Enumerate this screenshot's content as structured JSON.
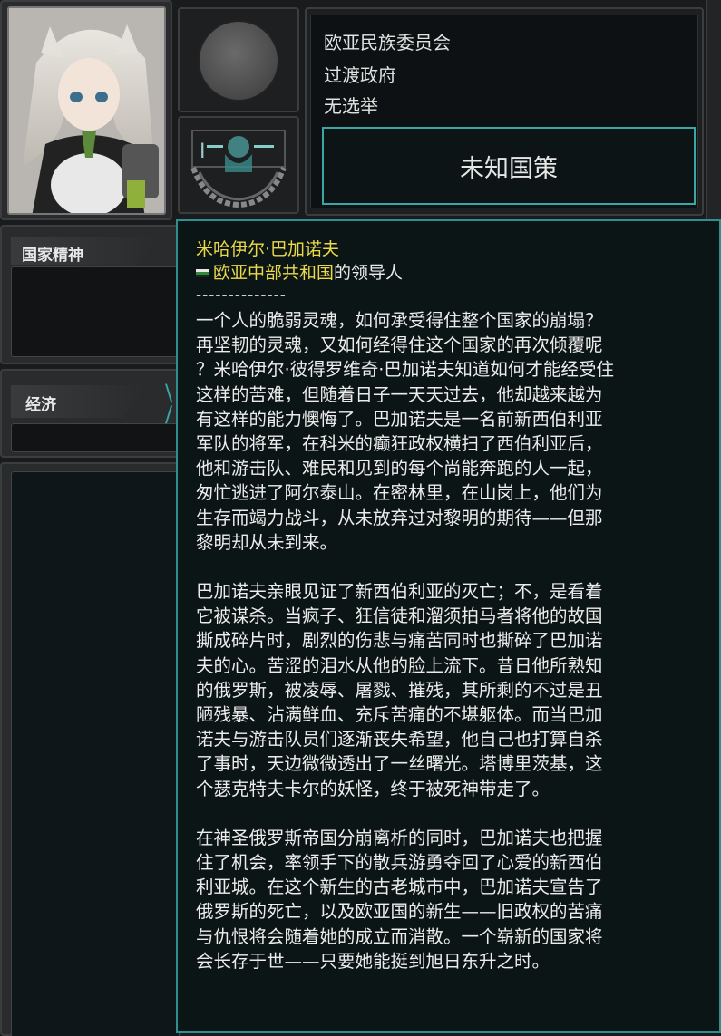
{
  "top": {
    "country_name": "欧亚民族委员会",
    "government": "过渡政府",
    "elections": "无选举",
    "policy_button": "未知国策"
  },
  "panels": {
    "national_spirit_label": "国家精神",
    "economy_label": "经济"
  },
  "tooltip": {
    "leader_name": "米哈伊尔·巴加诺夫",
    "country": "欧亚中部共和国",
    "role_suffix": "的领导人",
    "separator": "--------------",
    "paragraphs": [
      "一个人的脆弱灵魂，如何承受得住整个国家的崩塌？\n再坚韧的灵魂，又如何经得住这个国家的再次倾覆呢\n？米哈伊尔·彼得罗维奇·巴加诺夫知道如何才能经受住\n这样的苦难，但随着日子一天天过去，他却越来越为\n有这样的能力懊悔了。巴加诺夫是一名前新西伯利亚\n军队的将军，在科米的癫狂政权横扫了西伯利亚后，\n他和游击队、难民和见到的每个尚能奔跑的人一起，\n匆忙逃进了阿尔泰山。在密林里，在山岗上，他们为\n生存而竭力战斗，从未放弃过对黎明的期待——但那\n黎明却从未到来。",
      "巴加诺夫亲眼见证了新西伯利亚的灭亡；不，是看着\n它被谋杀。当疯子、狂信徒和溜须拍马者将他的故国\n撕成碎片时，剧烈的伤悲与痛苦同时也撕碎了巴加诺\n夫的心。苦涩的泪水从他的脸上流下。昔日他所熟知\n的俄罗斯，被凌辱、屠戮、摧残，其所剩的不过是丑\n陋残暴、沾满鲜血、充斥苦痛的不堪躯体。而当巴加\n诺夫与游击队员们逐渐丧失希望，他自己也打算自杀\n了事时，天边微微透出了一丝曙光。塔博里茨基，这\n个瑟克特夫卡尔的妖怪，终于被死神带走了。",
      "在神圣俄罗斯帝国分崩离析的同时，巴加诺夫也把握\n住了机会，率领手下的散兵游勇夺回了心爱的新西伯\n利亚城。在这个新生的古老城市中，巴加诺夫宣告了\n俄罗斯的死亡，以及欧亚国的新生——旧政权的苦痛\n与仇恨将会随着她的成立而消散。一个崭新的国家将\n会长存于世——只要她能挺到旭日东升之时。"
    ]
  },
  "colors": {
    "accent": "#2f8e8e",
    "name_highlight": "#e9d94a"
  }
}
